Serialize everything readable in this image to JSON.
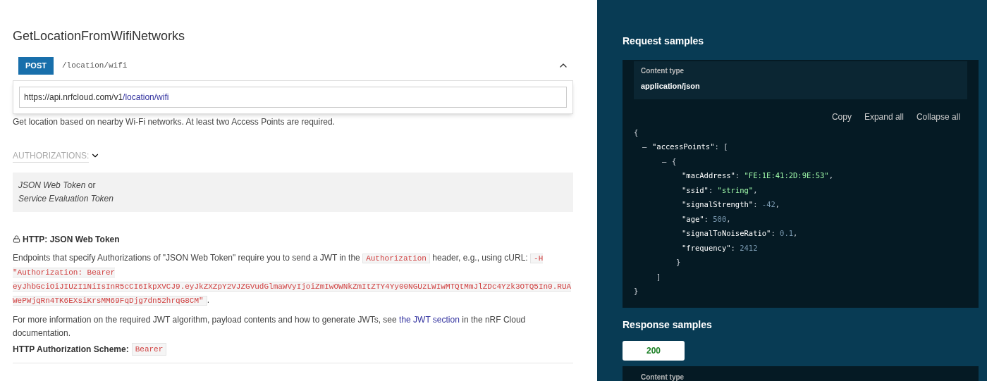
{
  "operation": {
    "title": "GetLocationFromWifiNetworks",
    "method": "POST",
    "path": "/location/wifi",
    "expanded": true,
    "url": {
      "base": "https://api.nrfcloud.com/v1",
      "path": "/location/wifi"
    },
    "description": "Get location based on nearby Wi-Fi networks. At least two Access Points are required.",
    "authorizations_label": "AUTHORIZATIONS:",
    "authorizations_expanded": false,
    "auth_options": [
      {
        "name": "JSON Web Token",
        "suffix": " or"
      },
      {
        "name": "Service Evaluation Token"
      }
    ],
    "security": {
      "title": "HTTP: JSON Web Token",
      "paragraphs": [
        [
          {
            "kind": "text",
            "text": "Endpoints that specify Authorizations of \"JSON Web Token\" require you to send a JWT in the "
          },
          {
            "kind": "code",
            "text": "Authorization"
          },
          {
            "kind": "text",
            "text": " header, e.g., using cURL: "
          },
          {
            "kind": "code",
            "text": "-H \"Authorization: Bearer eyJhbGciOiJIUzI1NiIsInR5cCI6IkpXVCJ9.eyJkZXZpY2VJZGVudGlmaWVyIjoiZmIwOWNkZmItZTY4Yy00NGUzLWIwMTQtMmJlZDc4Yzk3OTQ5In0.RUAWePWjqRn4TK6EXsiKrsMM69FqDjg7dn52hrqG8CM\""
          },
          {
            "kind": "text",
            "text": "."
          }
        ],
        [
          {
            "kind": "text",
            "text": "For more information on the required JWT algorithm, payload contents and how to generate JWTs, see "
          },
          {
            "kind": "link",
            "text": "the JWT section"
          },
          {
            "kind": "text",
            "text": " in the nRF Cloud documentation."
          }
        ]
      ],
      "scheme_label": "HTTP Authorization Scheme:",
      "scheme_value": "Bearer"
    }
  },
  "request_samples": {
    "title": "Request samples",
    "content_type_label": "Content type",
    "content_type": "application/json",
    "actions": [
      "Copy",
      "Expand all",
      "Collapse all"
    ],
    "code": [
      {
        "parts": [
          {
            "kind": "punct",
            "text": "{"
          }
        ],
        "close": "}",
        "children": [
          {
            "toggle": "–",
            "parts": [
              {
                "kind": "key",
                "text": "\"accessPoints\""
              },
              {
                "kind": "punct",
                "text": ": ["
              }
            ],
            "close": "]",
            "children": [
              {
                "toggle": "–",
                "parts": [
                  {
                    "kind": "punct",
                    "text": "{"
                  }
                ],
                "close": "}",
                "children": [
                  {
                    "parts": [
                      {
                        "kind": "key",
                        "text": "\"macAddress\""
                      },
                      {
                        "kind": "punct",
                        "text": ": "
                      },
                      {
                        "kind": "string",
                        "text": "\"FE:1E:41:2D:9E:53\""
                      },
                      {
                        "kind": "punct",
                        "text": ","
                      }
                    ]
                  },
                  {
                    "parts": [
                      {
                        "kind": "key",
                        "text": "\"ssid\""
                      },
                      {
                        "kind": "punct",
                        "text": ": "
                      },
                      {
                        "kind": "string",
                        "text": "\"string\""
                      },
                      {
                        "kind": "punct",
                        "text": ","
                      }
                    ]
                  },
                  {
                    "parts": [
                      {
                        "kind": "key",
                        "text": "\"signalStrength\""
                      },
                      {
                        "kind": "punct",
                        "text": ": "
                      },
                      {
                        "kind": "number",
                        "text": "-42"
                      },
                      {
                        "kind": "punct",
                        "text": ","
                      }
                    ]
                  },
                  {
                    "parts": [
                      {
                        "kind": "key",
                        "text": "\"age\""
                      },
                      {
                        "kind": "punct",
                        "text": ": "
                      },
                      {
                        "kind": "number",
                        "text": "500"
                      },
                      {
                        "kind": "punct",
                        "text": ","
                      }
                    ]
                  },
                  {
                    "parts": [
                      {
                        "kind": "key",
                        "text": "\"signalToNoiseRatio\""
                      },
                      {
                        "kind": "punct",
                        "text": ": "
                      },
                      {
                        "kind": "number",
                        "text": "0.1"
                      },
                      {
                        "kind": "punct",
                        "text": ","
                      }
                    ]
                  },
                  {
                    "parts": [
                      {
                        "kind": "key",
                        "text": "\"frequency\""
                      },
                      {
                        "kind": "punct",
                        "text": ": "
                      },
                      {
                        "kind": "number",
                        "text": "2412"
                      }
                    ]
                  }
                ]
              }
            ]
          }
        ]
      }
    ]
  },
  "response_samples": {
    "title": "Response samples",
    "tabs": [
      {
        "label": "200",
        "selected": true
      }
    ],
    "content_type_label": "Content type"
  }
}
